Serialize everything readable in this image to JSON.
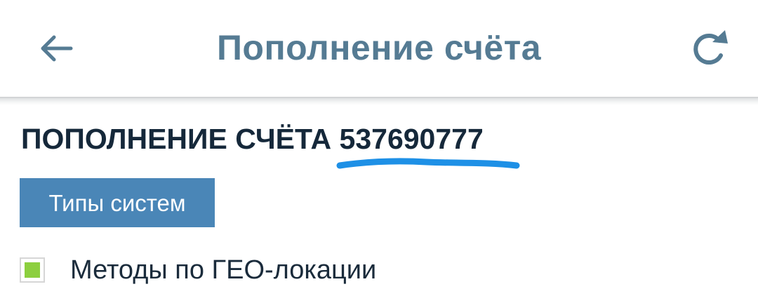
{
  "header": {
    "title": "Пополнение счёта",
    "back_icon": "arrow-left-icon",
    "refresh_icon": "refresh-icon"
  },
  "content": {
    "heading_prefix": "ПОПОЛНЕНИЕ СЧЁТА",
    "account_number": "537690777",
    "types_button_label": "Типы систем",
    "geo_label": "Методы по ГЕО-локации"
  },
  "colors": {
    "title": "#557b93",
    "heading": "#15283a",
    "button_bg": "#4a86b7",
    "highlight_stroke": "#1e90e6",
    "checkbox_fill": "#8ccf3e"
  }
}
